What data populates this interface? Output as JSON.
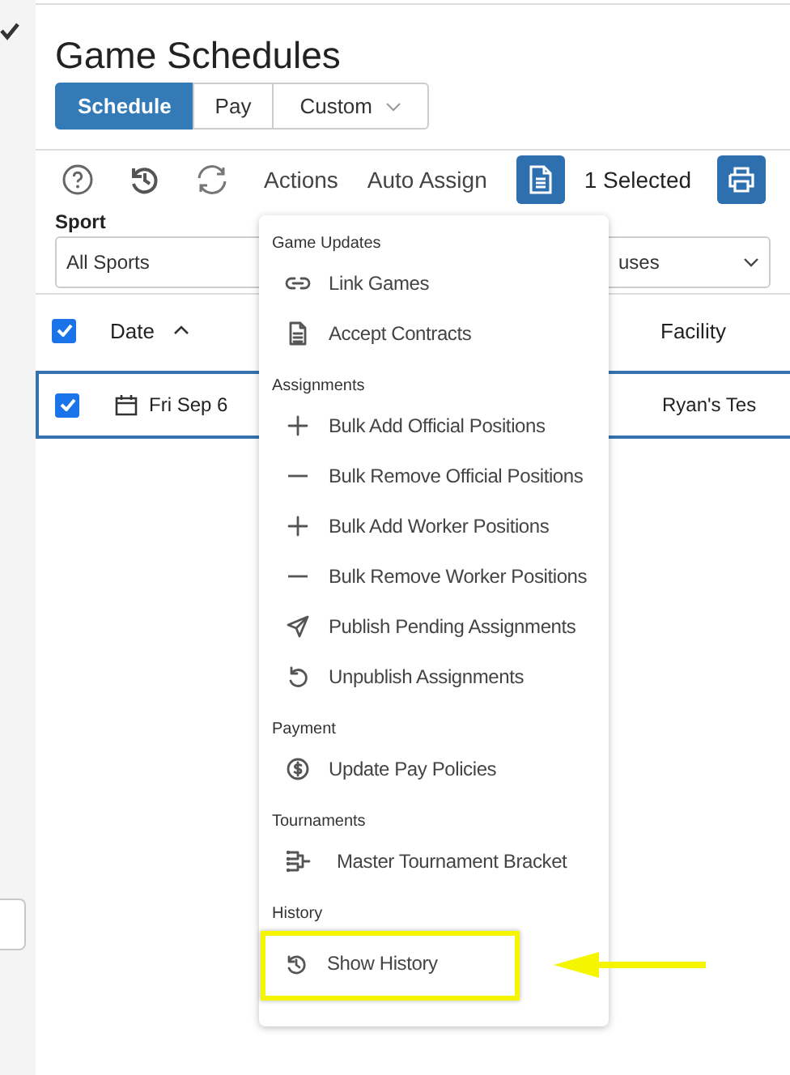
{
  "page": {
    "title": "Game Schedules"
  },
  "view_tabs": [
    {
      "label": "Schedule",
      "selected": true
    },
    {
      "label": "Pay",
      "selected": false
    },
    {
      "label": "Custom",
      "selected": false,
      "kind": "dropdown"
    }
  ],
  "toolbar": {
    "actions": "Actions",
    "auto_assign": "Auto Assign",
    "selected_count": "1 Selected"
  },
  "filters": [
    {
      "label": "Sport",
      "value": "All Sports"
    },
    {
      "value": "uses"
    }
  ],
  "table": {
    "all_checked": true,
    "columns": [
      {
        "label": "Date",
        "sorted_ascending": true
      },
      {
        "label": "Facility",
        "sorted_ascending": false
      }
    ],
    "rows": [
      {
        "checked": true,
        "selected": true,
        "date": "Fri Sep 6",
        "facility": "Ryan's Tes"
      }
    ]
  },
  "actions_menu": {
    "sections": [
      {
        "title": "Game Updates",
        "items": [
          {
            "label": "Link Games",
            "kind": "link",
            "highlighted": false
          },
          {
            "label": "Accept Contracts",
            "kind": "document",
            "highlighted": false
          }
        ]
      },
      {
        "title": "Assignments",
        "items": [
          {
            "label": "Bulk Add Official Positions",
            "kind": "add",
            "highlighted": false
          },
          {
            "label": "Bulk Remove Official Positions",
            "kind": "remove",
            "highlighted": false
          },
          {
            "label": "Bulk Add Worker Positions",
            "kind": "add",
            "highlighted": false
          },
          {
            "label": "Bulk Remove Worker Positions",
            "kind": "remove",
            "highlighted": false
          },
          {
            "label": "Publish Pending Assignments",
            "kind": "publish",
            "highlighted": false
          },
          {
            "label": "Unpublish Assignments",
            "kind": "unpublish",
            "highlighted": false
          }
        ]
      },
      {
        "title": "Payment",
        "items": [
          {
            "label": "Update Pay Policies",
            "kind": "pay",
            "highlighted": false
          }
        ]
      },
      {
        "title": "Tournaments",
        "items": [
          {
            "label": "Master Tournament Bracket",
            "kind": "bracket",
            "highlighted": false
          }
        ]
      },
      {
        "title": "History",
        "items": [
          {
            "label": "Show History",
            "kind": "history",
            "highlighted": true
          }
        ]
      }
    ]
  }
}
